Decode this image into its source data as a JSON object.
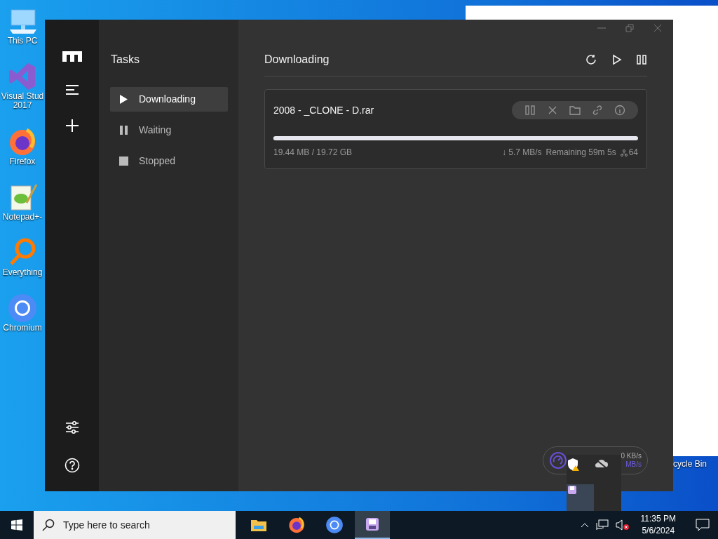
{
  "desktop": {
    "icons": [
      {
        "label": "This PC",
        "kind": "pc"
      },
      {
        "label": "Visual Stud 2017",
        "kind": "vs"
      },
      {
        "label": "Firefox",
        "kind": "firefox"
      },
      {
        "label": "Notepad+-",
        "kind": "notepad"
      },
      {
        "label": "Everything",
        "kind": "search"
      },
      {
        "label": "Chromium",
        "kind": "chromium"
      }
    ],
    "recycle_bin": {
      "label": "cycle Bin"
    }
  },
  "window": {
    "sidebar": {
      "title": "Tasks",
      "items": [
        {
          "label": "Downloading",
          "kind": "play",
          "selected": true
        },
        {
          "label": "Waiting",
          "kind": "pause",
          "selected": false
        },
        {
          "label": "Stopped",
          "kind": "stop",
          "selected": false
        }
      ]
    },
    "heading": "Downloading",
    "tasks": [
      {
        "name": "2008 - _CLONE - D.rar",
        "level": 0.001,
        "size": "19.44 MB / 19.72 GB",
        "speed": "↓ 5.7 MB/s",
        "remaining": "Remaining 59m 5s",
        "connections": "64"
      }
    ],
    "speed_widget": {
      "upload": "0 KB/s",
      "download": "MB/s"
    }
  },
  "taskbar": {
    "search": {
      "placeholder": "Type here to search"
    },
    "apps": [
      {
        "kind": "folder",
        "selected": false
      },
      {
        "kind": "firefox",
        "selected": false
      },
      {
        "kind": "chromium",
        "selected": false
      },
      {
        "kind": "motrix",
        "selected": true
      }
    ],
    "time": "11:35 PM",
    "date": "5/6/2024"
  }
}
